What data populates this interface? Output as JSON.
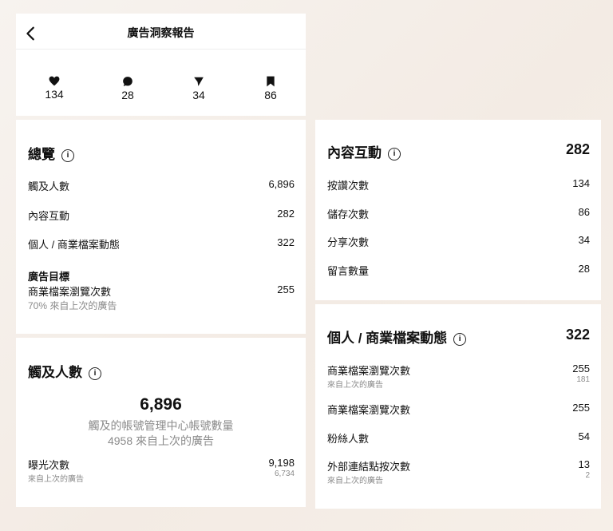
{
  "header": {
    "title": "廣告洞察報告"
  },
  "stats": [
    {
      "icon": "heart-icon",
      "value": "134"
    },
    {
      "icon": "comment-icon",
      "value": "28"
    },
    {
      "icon": "share-icon",
      "value": "34"
    },
    {
      "icon": "bookmark-icon",
      "value": "86"
    }
  ],
  "overview": {
    "title": "總覽",
    "rows": [
      {
        "label": "觸及人數",
        "value": "6,896"
      },
      {
        "label": "內容互動",
        "value": "282"
      },
      {
        "label": "個人 / 商業檔案動態",
        "value": "322"
      }
    ],
    "goal": {
      "heading": "廣告目標",
      "label": "商業檔案瀏覽次數",
      "value": "255",
      "note": "70% 來自上次的廣告"
    }
  },
  "reach": {
    "title": "觸及人數",
    "big": "6,896",
    "desc1": "觸及的帳號管理中心帳號數量",
    "desc2": "4958 來自上次的廣告",
    "row": {
      "label": "曝光次數",
      "sub": "來自上次的廣告",
      "value": "9,198",
      "subvalue": "6,734"
    }
  },
  "content": {
    "title": "內容互動",
    "total": "282",
    "rows": [
      {
        "label": "按讚次數",
        "value": "134"
      },
      {
        "label": "儲存次數",
        "value": "86"
      },
      {
        "label": "分享次數",
        "value": "34"
      },
      {
        "label": "留言數量",
        "value": "28"
      }
    ]
  },
  "profile": {
    "title": "個人 / 商業檔案動態",
    "total": "322",
    "rows": [
      {
        "label": "商業檔案瀏覽次數",
        "sub": "來自上次的廣告",
        "value": "255",
        "subvalue": "181"
      },
      {
        "label": "商業檔案瀏覽次數",
        "value": "255"
      },
      {
        "label": "粉絲人數",
        "value": "54"
      },
      {
        "label": "外部連結點按次數",
        "sub": "來自上次的廣告",
        "value": "13",
        "subvalue": "2"
      }
    ]
  }
}
